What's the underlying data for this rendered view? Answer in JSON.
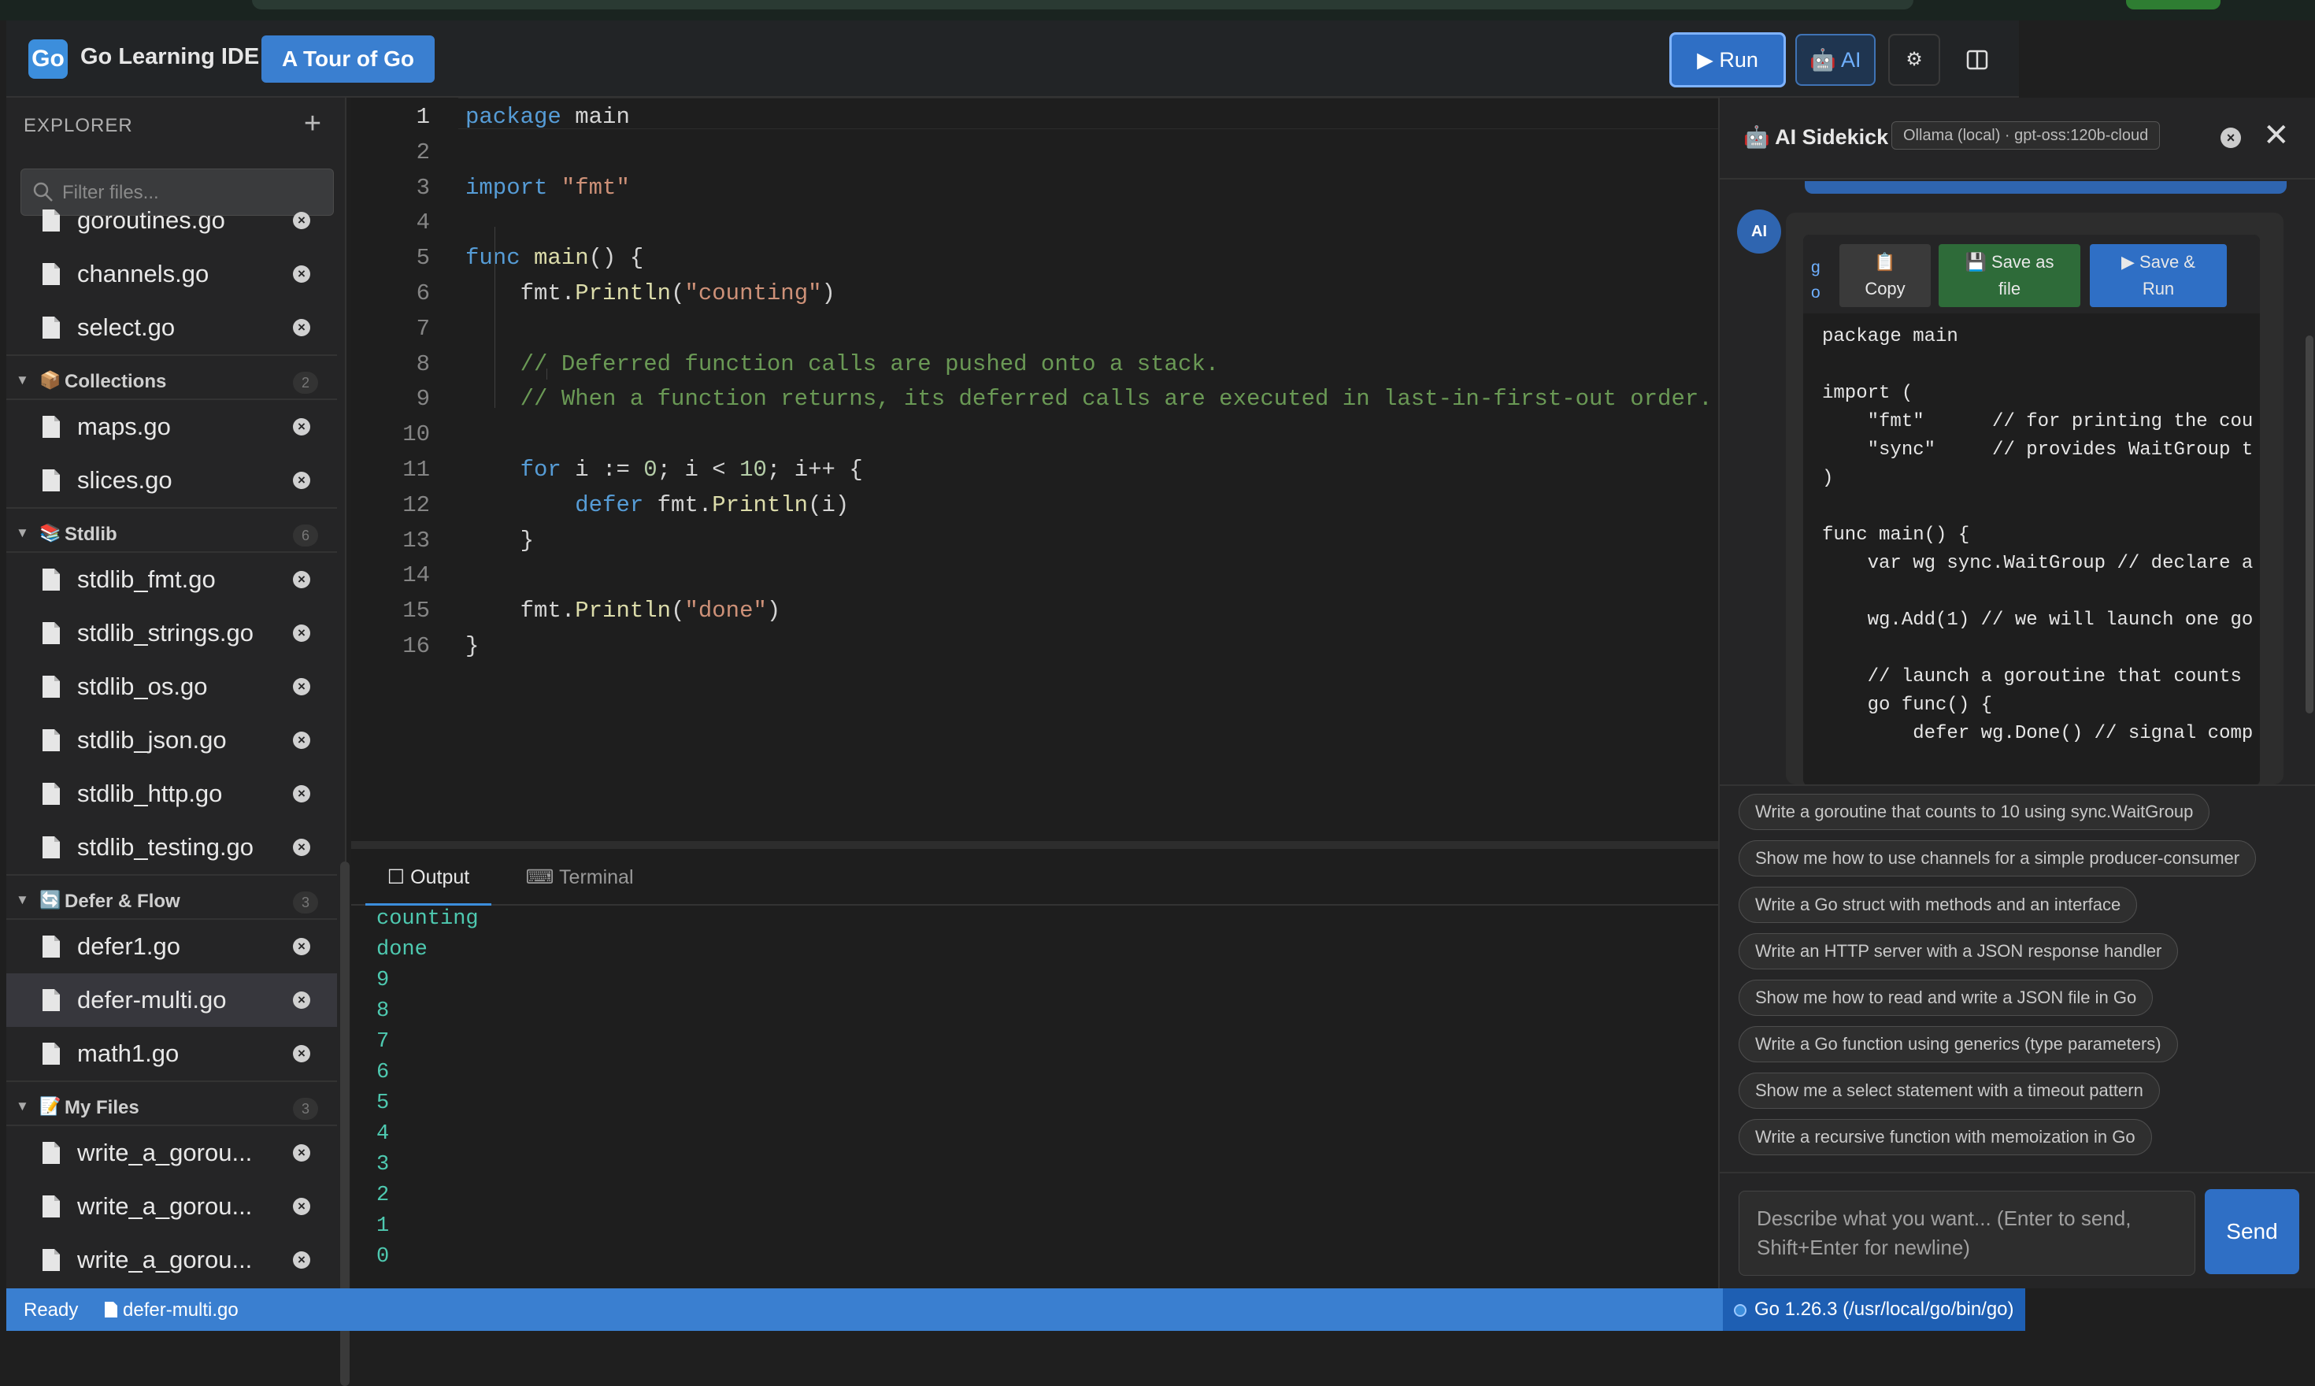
{
  "header": {
    "logo": "Go",
    "app_title": "Go Learning IDE",
    "tour_button": "A Tour of Go",
    "run_button": "▶ Run",
    "ai_button": "🤖 AI",
    "settings_icon": "⚙"
  },
  "explorer": {
    "title": "EXPLORER",
    "add_icon": "+",
    "filter_placeholder": "Filter files...",
    "rows": [
      {
        "type": "file",
        "name": "goroutines.go"
      },
      {
        "type": "file",
        "name": "channels.go"
      },
      {
        "type": "file",
        "name": "select.go"
      },
      {
        "type": "folder",
        "emoji": "📦",
        "label": "Collections",
        "count": "2"
      },
      {
        "type": "file",
        "name": "maps.go"
      },
      {
        "type": "file",
        "name": "slices.go"
      },
      {
        "type": "folder",
        "emoji": "📚",
        "label": "Stdlib",
        "count": "6"
      },
      {
        "type": "file",
        "name": "stdlib_fmt.go"
      },
      {
        "type": "file",
        "name": "stdlib_strings.go"
      },
      {
        "type": "file",
        "name": "stdlib_os.go"
      },
      {
        "type": "file",
        "name": "stdlib_json.go"
      },
      {
        "type": "file",
        "name": "stdlib_http.go"
      },
      {
        "type": "file",
        "name": "stdlib_testing.go"
      },
      {
        "type": "folder",
        "emoji": "🔄",
        "label": "Defer & Flow",
        "count": "3"
      },
      {
        "type": "file",
        "name": "defer1.go"
      },
      {
        "type": "file",
        "name": "defer-multi.go",
        "active": true
      },
      {
        "type": "file",
        "name": "math1.go"
      },
      {
        "type": "folder",
        "emoji": "📝",
        "label": "My Files",
        "count": "3"
      },
      {
        "type": "file",
        "name": "write_a_gorou..."
      },
      {
        "type": "file",
        "name": "write_a_gorou..."
      },
      {
        "type": "file",
        "name": "write_a_gorou..."
      }
    ]
  },
  "editor": {
    "current_line": 1,
    "lines": [
      "package main",
      "",
      "import \"fmt\"",
      "",
      "func main() {",
      "    fmt.Println(\"counting\")",
      "",
      "    // Deferred function calls are pushed onto a stack.",
      "    // When a function returns, its deferred calls are executed in last-in-first-out order.",
      "",
      "    for i := 0; i < 10; i++ {",
      "        defer fmt.Println(i)",
      "    }",
      "",
      "    fmt.Println(\"done\")",
      "}"
    ]
  },
  "panel": {
    "tabs": [
      {
        "icon": "☐",
        "label": "Output"
      },
      {
        "icon": "⌨",
        "label": "Terminal"
      }
    ],
    "output_lines": [
      "counting",
      "done",
      "9",
      "8",
      "7",
      "6",
      "5",
      "4",
      "3",
      "2",
      "1",
      "0"
    ]
  },
  "ai": {
    "title": "🤖 AI Sidekick",
    "model": "Ollama (local) · gpt-oss:120b-cloud",
    "clear_icon": "×",
    "close_icon": "✕",
    "avatar": "AI",
    "code_block": {
      "lang": "go",
      "copy_icon": "📋",
      "copy_label": "Copy",
      "save_icon": "💾",
      "save_label_1": "Save as",
      "save_label_2": "file",
      "run_label_1": "▶ Save &",
      "run_label_2": "Run",
      "code": "package main\n\nimport (\n    \"fmt\"      // for printing the cou\n    \"sync\"     // provides WaitGroup t\n)\n\nfunc main() {\n    var wg sync.WaitGroup // declare a\n\n    wg.Add(1) // we will launch one go\n\n    // launch a goroutine that counts\n    go func() {\n        defer wg.Done() // signal comp"
    },
    "suggestions": [
      "Write a goroutine that counts to 10 using sync.WaitGroup",
      "Show me how to use channels for a simple producer-consumer",
      "Write a Go struct with methods and an interface",
      "Write an HTTP server with a JSON response handler",
      "Show me how to read and write a JSON file in Go",
      "Write a Go function using generics (type parameters)",
      "Show me a select statement with a timeout pattern",
      "Write a recursive function with memoization in Go"
    ],
    "input_placeholder": "Describe what you want... (Enter to send, Shift+Enter for newline)",
    "send_label": "Send"
  },
  "status": {
    "ready": "Ready",
    "file": "defer-multi.go",
    "go_version": "Go 1.26.3 (/usr/local/go/bin/go)"
  },
  "colors": {
    "accent": "#3a7fd0",
    "editor_bg": "#1e1e1e",
    "sidebar_bg": "#252526",
    "output_text": "#4ec9b0"
  }
}
